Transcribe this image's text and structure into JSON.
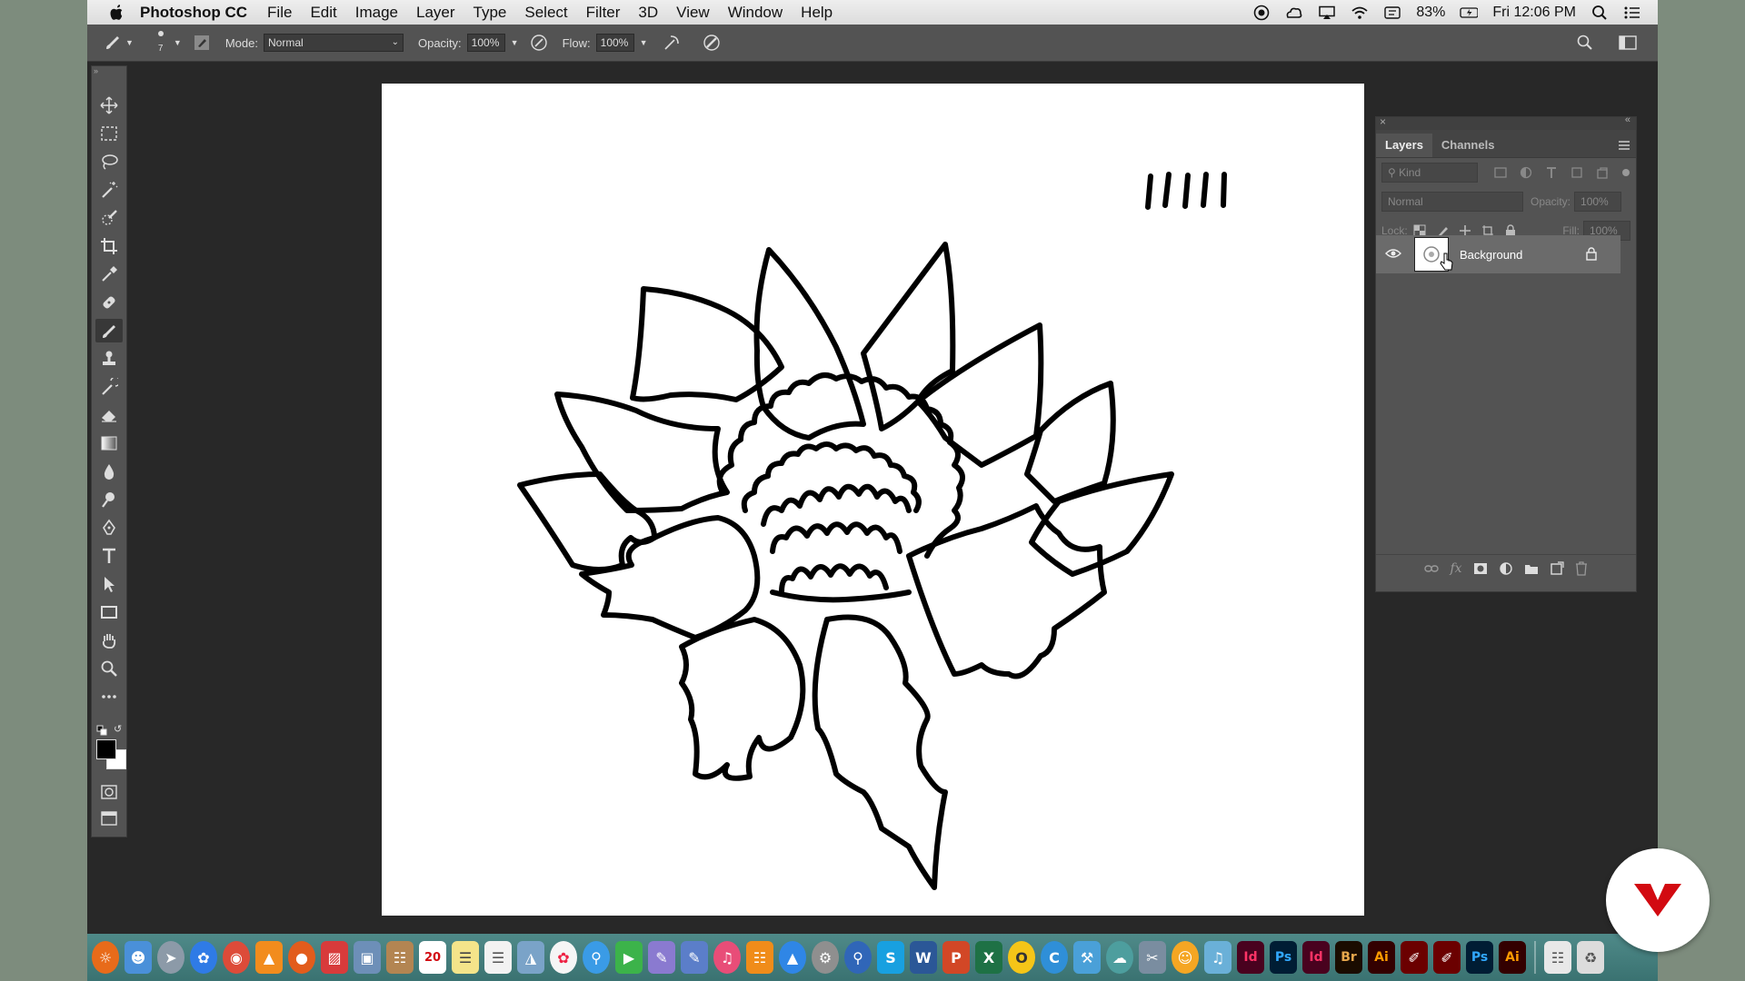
{
  "menubar": {
    "app_name": "Photoshop CC",
    "menus": [
      "File",
      "Edit",
      "Image",
      "Layer",
      "Type",
      "Select",
      "Filter",
      "3D",
      "View",
      "Window",
      "Help"
    ],
    "battery": "83%",
    "clock": "Fri 12:06 PM"
  },
  "options": {
    "brush_size": "7",
    "mode_label": "Mode:",
    "mode_value": "Normal",
    "opacity_label": "Opacity:",
    "opacity_value": "100%",
    "flow_label": "Flow:",
    "flow_value": "100%"
  },
  "layers_panel": {
    "tabs": [
      "Layers",
      "Channels"
    ],
    "kind_placeholder": "Kind",
    "blend_mode": "Normal",
    "opacity_label": "Opacity:",
    "opacity_value": "100%",
    "lock_label": "Lock:",
    "fill_label": "Fill:",
    "fill_value": "100%",
    "layer_name": "Background"
  },
  "dock": {
    "calendar_day": "20",
    "apps": [
      "Id",
      "Ps",
      "Id",
      "Br",
      "Ai",
      "Ps",
      "Ai"
    ]
  },
  "colors": {
    "accent": "#d20a11",
    "panel": "#535353",
    "workspace": "#282828"
  }
}
